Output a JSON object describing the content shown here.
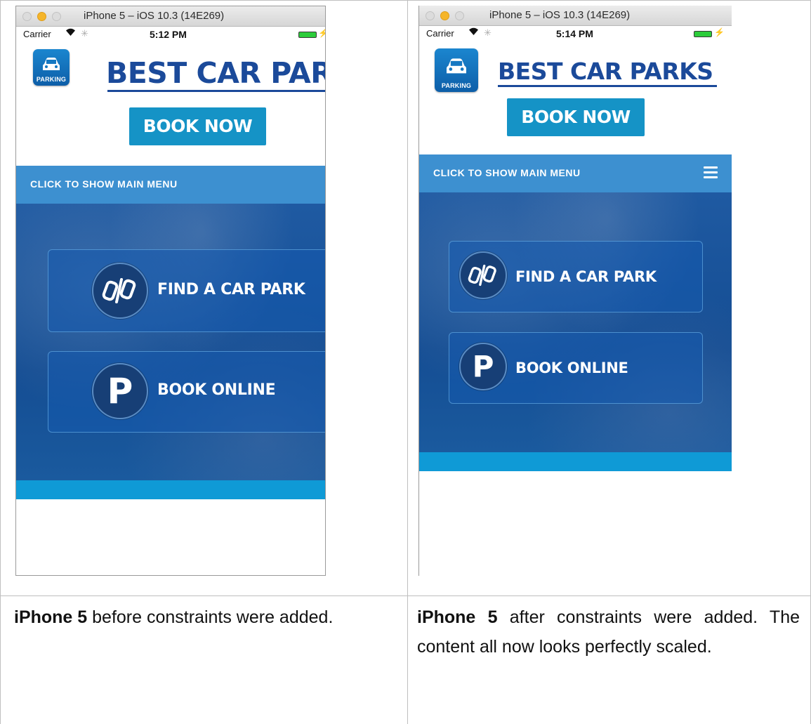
{
  "simulator": {
    "window_title": "iPhone 5 – iOS 10.3 (14E269)",
    "carrier": "Carrier",
    "wifi_icon": "wifi-icon",
    "left_time": "5:12 PM",
    "right_time": "5:14 PM"
  },
  "app": {
    "logo_text": "PARKING",
    "brand_left": "BEST CAR PAR",
    "brand_right": "BEST CAR PARKS",
    "book_now": "BOOK NOW",
    "menu_label": "CLICK TO SHOW MAIN MENU",
    "find_car_park": "FIND A CAR PARK",
    "book_online": "BOOK ONLINE",
    "parking_glyph": "P"
  },
  "captions": {
    "left_bold": "iPhone 5",
    "left_rest": " before constraints were added.",
    "right_bold": "iPhone 5",
    "right_rest": " after constraints were added. The content all now looks perfectly scaled."
  },
  "colors": {
    "menu_bar": "#3d90d0",
    "brand_text": "#1b4a9a",
    "book_now_bg": "#1593c6",
    "footer_strip": "#0f9ad6"
  }
}
